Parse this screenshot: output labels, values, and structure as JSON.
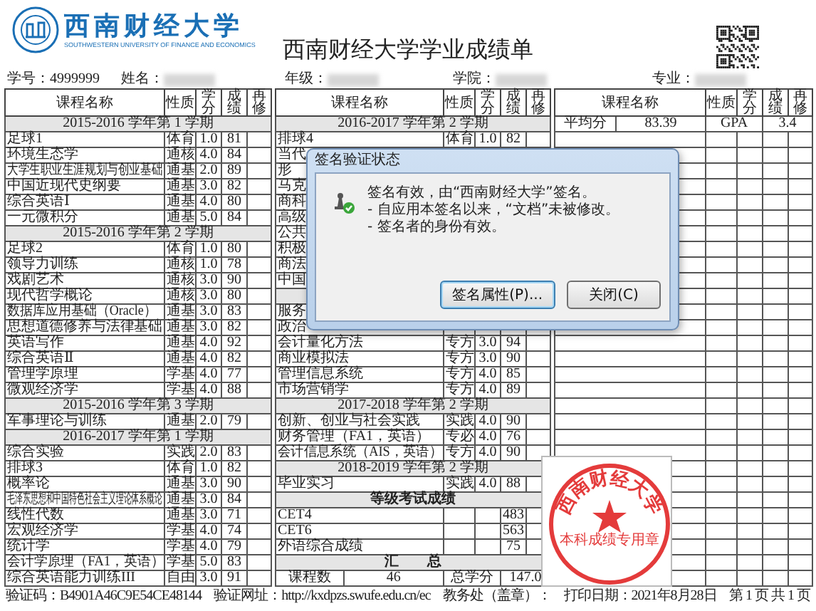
{
  "header": {
    "logo_cn": "西南财经大学",
    "logo_en": "SOUTHWESTERN UNIVERSITY OF FINANCE AND ECONOMICS",
    "title": "西南财经大学学业成绩单"
  },
  "info": [
    {
      "label": "学号：",
      "value": "4999999",
      "blurred": false
    },
    {
      "label": "姓名：",
      "blurred": true
    },
    {
      "label": "年级：",
      "blurred": true
    },
    {
      "label": "学院：",
      "blurred": true
    },
    {
      "label": "专业：",
      "blurred": true
    }
  ],
  "tables": [
    {
      "columns": [
        "课程名称",
        "性质",
        "学分",
        "成绩",
        "再修"
      ],
      "rows": [
        {
          "kind": "semester",
          "text": "2015-2016 学年第 1 学期"
        },
        {
          "kind": "course",
          "name": "足球1",
          "type": "体育",
          "credit": "1.0",
          "score": "81"
        },
        {
          "kind": "course",
          "name": "环境生态学",
          "type": "通核",
          "credit": "4.0",
          "score": "84"
        },
        {
          "kind": "course",
          "name": "大学生职业生涯规划与创业基础",
          "type": "通基",
          "credit": "2.0",
          "score": "89"
        },
        {
          "kind": "course",
          "name": "中国近现代史纲要",
          "type": "通基",
          "credit": "3.0",
          "score": "82"
        },
        {
          "kind": "course",
          "name": "综合英语Ⅰ",
          "type": "通基",
          "credit": "4.0",
          "score": "80"
        },
        {
          "kind": "course",
          "name": "一元微积分",
          "type": "通基",
          "credit": "5.0",
          "score": "84"
        },
        {
          "kind": "semester",
          "text": "2015-2016 学年第 2 学期"
        },
        {
          "kind": "course",
          "name": "足球2",
          "type": "体育",
          "credit": "1.0",
          "score": "80"
        },
        {
          "kind": "course",
          "name": "领导力训练",
          "type": "通核",
          "credit": "1.0",
          "score": "78"
        },
        {
          "kind": "course",
          "name": "戏剧艺术",
          "type": "通核",
          "credit": "3.0",
          "score": "90"
        },
        {
          "kind": "course",
          "name": "现代哲学概论",
          "type": "通核",
          "credit": "3.0",
          "score": "80"
        },
        {
          "kind": "course",
          "name": "数据库应用基础（Oracle）",
          "type": "通基",
          "credit": "3.0",
          "score": "83"
        },
        {
          "kind": "course",
          "name": "思想道德修养与法律基础",
          "type": "通基",
          "credit": "3.0",
          "score": "82"
        },
        {
          "kind": "course",
          "name": "英语写作",
          "type": "通基",
          "credit": "4.0",
          "score": "92"
        },
        {
          "kind": "course",
          "name": "综合英语Ⅱ",
          "type": "通基",
          "credit": "4.0",
          "score": "82"
        },
        {
          "kind": "course",
          "name": "管理学原理",
          "type": "学基",
          "credit": "4.0",
          "score": "77"
        },
        {
          "kind": "course",
          "name": "微观经济学",
          "type": "学基",
          "credit": "4.0",
          "score": "88"
        },
        {
          "kind": "semester",
          "text": "2015-2016 学年第 3 学期"
        },
        {
          "kind": "course",
          "name": "军事理论与训练",
          "type": "通基",
          "credit": "2.0",
          "score": "79"
        },
        {
          "kind": "semester",
          "text": "2016-2017 学年第 1 学期"
        },
        {
          "kind": "course",
          "name": "综合实验",
          "type": "实践",
          "credit": "2.0",
          "score": "83"
        },
        {
          "kind": "course",
          "name": "排球3",
          "type": "体育",
          "credit": "1.0",
          "score": "82"
        },
        {
          "kind": "course",
          "name": "概率论",
          "type": "通基",
          "credit": "3.0",
          "score": "90"
        },
        {
          "kind": "course",
          "name": "毛泽东思想和中国特色社会主义理论体系概论",
          "type": "通基",
          "credit": "3.0",
          "score": "84"
        },
        {
          "kind": "course",
          "name": "线性代数",
          "type": "通基",
          "credit": "3.0",
          "score": "71"
        },
        {
          "kind": "course",
          "name": "宏观经济学",
          "type": "学基",
          "credit": "4.0",
          "score": "74"
        },
        {
          "kind": "course",
          "name": "统计学",
          "type": "学基",
          "credit": "4.0",
          "score": "79"
        },
        {
          "kind": "course",
          "name": "会计学原理（FA1，英语）",
          "type": "学基",
          "credit": "5.0",
          "score": "83"
        },
        {
          "kind": "course",
          "name": "综合英语能力训练III",
          "type": "自由",
          "credit": "3.0",
          "score": "91"
        }
      ]
    },
    {
      "columns": [
        "课程名称",
        "性质",
        "学分",
        "成绩",
        "再修"
      ],
      "rows": [
        {
          "kind": "semester",
          "text": "2016-2017 学年第 2 学期"
        },
        {
          "kind": "course",
          "name": "排球4",
          "type": "体育",
          "credit": "1.0",
          "score": "82"
        },
        {
          "kind": "course",
          "name": "当代"
        },
        {
          "kind": "course",
          "name": "形"
        },
        {
          "kind": "course",
          "name": "马克"
        },
        {
          "kind": "course",
          "name": "商科"
        },
        {
          "kind": "course",
          "name": "高级"
        },
        {
          "kind": "course",
          "name": "公共"
        },
        {
          "kind": "course",
          "name": "积极"
        },
        {
          "kind": "course",
          "name": "商法"
        },
        {
          "kind": "course",
          "name": "中国"
        },
        {
          "kind": "blank",
          "shaded": true
        },
        {
          "kind": "course",
          "name": "服务"
        },
        {
          "kind": "course",
          "name": "政治"
        },
        {
          "kind": "course",
          "name": "会计量化方法",
          "type": "专方",
          "credit": "3.0",
          "score": "94"
        },
        {
          "kind": "course",
          "name": "商业模拟法",
          "type": "专方",
          "credit": "3.0",
          "score": "90"
        },
        {
          "kind": "course",
          "name": "管理信息系统",
          "type": "专方",
          "credit": "4.0",
          "score": "85"
        },
        {
          "kind": "course",
          "name": "市场营销学",
          "type": "专方",
          "credit": "4.0",
          "score": "89"
        },
        {
          "kind": "semester",
          "text": "2017-2018 学年第 2 学期"
        },
        {
          "kind": "course",
          "name": "创新、创业与社会实践",
          "type": "实践",
          "credit": "4.0",
          "score": "90"
        },
        {
          "kind": "course",
          "name": "财务管理（FA1，英语）",
          "type": "专必",
          "credit": "4.0",
          "score": "76"
        },
        {
          "kind": "course",
          "name": "会计信息系统（AIS，英语）",
          "type": "专方",
          "credit": "4.0",
          "score": "90"
        },
        {
          "kind": "semester",
          "text": "2018-2019 学年第 2 学期"
        },
        {
          "kind": "course",
          "name": "毕业实习",
          "type": "实践",
          "credit": "4.0",
          "score": "88"
        },
        {
          "kind": "section",
          "text": "等级考试成绩"
        },
        {
          "kind": "course",
          "name": "CET4",
          "score": "483"
        },
        {
          "kind": "course",
          "name": "CET6",
          "score": "563"
        },
        {
          "kind": "course",
          "name": "外语综合成绩",
          "score": "75"
        },
        {
          "kind": "section",
          "text": "汇　　总"
        },
        {
          "kind": "summary",
          "cells": [
            "课程数",
            "46",
            "总学分",
            "147.0"
          ]
        }
      ]
    },
    {
      "columns": [
        "课程名称",
        "性质",
        "学分",
        "成绩",
        "再修"
      ],
      "rows": [
        {
          "kind": "summary",
          "cells": [
            "平均分",
            "83.39",
            "GPA",
            "3.4"
          ]
        },
        {
          "kind": "blank",
          "shaded": false
        },
        {
          "kind": "blank",
          "shaded": false
        },
        {
          "kind": "blank",
          "shaded": false
        },
        {
          "kind": "blank",
          "shaded": false
        },
        {
          "kind": "blank",
          "shaded": false
        },
        {
          "kind": "blank",
          "shaded": false
        },
        {
          "kind": "blank",
          "shaded": false
        },
        {
          "kind": "blank",
          "shaded": false
        },
        {
          "kind": "blank",
          "shaded": false
        },
        {
          "kind": "blank",
          "shaded": false
        },
        {
          "kind": "blank",
          "shaded": false
        },
        {
          "kind": "blank",
          "shaded": false
        },
        {
          "kind": "blank",
          "shaded": false
        },
        {
          "kind": "blank",
          "shaded": false
        },
        {
          "kind": "blank",
          "shaded": false
        },
        {
          "kind": "blank",
          "shaded": false
        },
        {
          "kind": "blank",
          "shaded": false
        },
        {
          "kind": "blank",
          "shaded": false
        },
        {
          "kind": "blank",
          "shaded": false
        },
        {
          "kind": "blank",
          "shaded": false
        },
        {
          "kind": "blank",
          "shaded": false
        },
        {
          "kind": "blank",
          "shaded": false
        },
        {
          "kind": "blank",
          "shaded": false
        },
        {
          "kind": "blank",
          "shaded": false
        },
        {
          "kind": "blank",
          "shaded": false
        },
        {
          "kind": "blank",
          "shaded": false
        },
        {
          "kind": "blank",
          "shaded": false
        },
        {
          "kind": "blank",
          "shaded": false
        },
        {
          "kind": "blank",
          "shaded": false
        }
      ]
    }
  ],
  "footer": [
    "验证码：B4901A46C9E54CE48144",
    "验证网址：http://kxdpzs.swufe.edu.cn/ec",
    "教务处（盖章）：",
    "打印日期：2021年8月28日",
    "第 1 页 共 1 页"
  ],
  "stamp": {
    "arc_text": "西南财经大学",
    "bottom_text": "本科成绩专用章"
  },
  "dialog": {
    "title": "签名验证状态",
    "messages": [
      "签名有效，由“西南财经大学”签名。",
      "- 自应用本签名以来，“文档”未被修改。",
      "- 签名者的身份有效。"
    ],
    "buttons": [
      "签名属性(P)...",
      "关闭(C)"
    ]
  }
}
